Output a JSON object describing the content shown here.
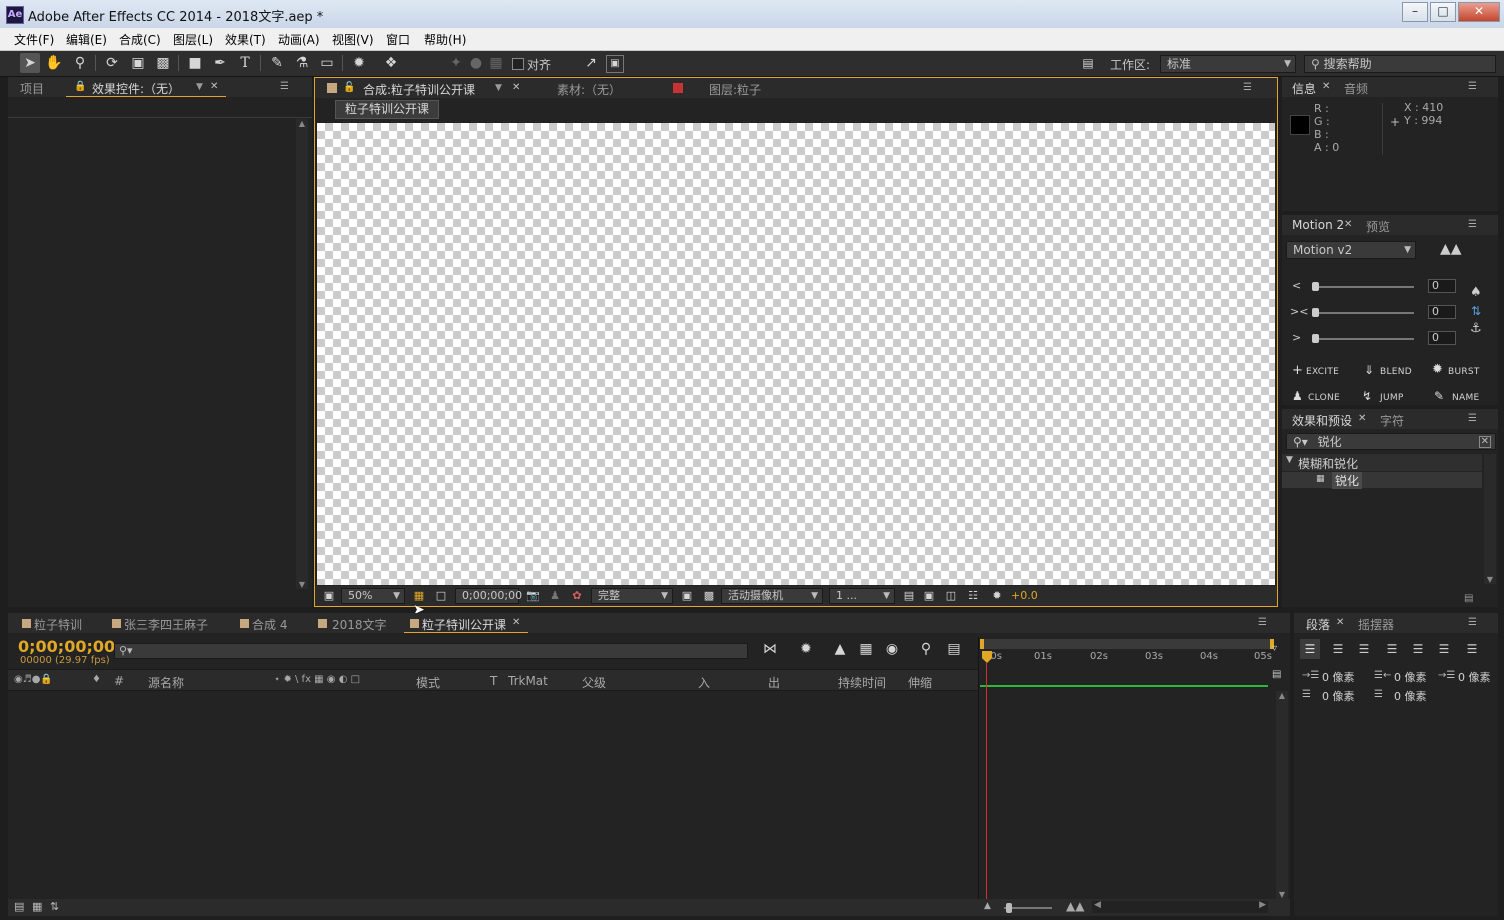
{
  "window": {
    "title": "Adobe After Effects CC 2014 - 2018文字.aep *",
    "app_icon": "Ae",
    "controls": [
      "minimize-icon",
      "maximize-icon",
      "close-icon"
    ]
  },
  "menu": [
    "文件(F)",
    "编辑(E)",
    "合成(C)",
    "图层(L)",
    "效果(T)",
    "动画(A)",
    "视图(V)",
    "窗口",
    "帮助(H)"
  ],
  "toolbar": {
    "snap_label": "对齐",
    "workspace_label": "工作区:",
    "workspace_value": "标准",
    "search_placeholder": "搜索帮助"
  },
  "left_panel": {
    "tabs": [
      "项目",
      "效果控件:（无）"
    ]
  },
  "comp_panel": {
    "tabs": [
      "合成:粒子特训公开课",
      "素材:（无）",
      "图层:粒子"
    ],
    "comp_button": "粒子特训公开课",
    "footer": {
      "zoom": "50%",
      "timecode": "0;00;00;00",
      "quality": "完整",
      "camera": "活动摄像机",
      "views": "1 ...",
      "exposure": "+0.0"
    }
  },
  "info_panel": {
    "tabs": [
      "信息",
      "音频"
    ],
    "rgba": [
      "R :",
      "G :",
      "B :",
      "A : 0"
    ],
    "x": "X : 410",
    "y": "Y : 994"
  },
  "motion_panel": {
    "tabs": [
      "Motion 2",
      "预览"
    ],
    "preset": "Motion v2",
    "values": [
      "0",
      "0",
      "0"
    ],
    "buttons": [
      "EXCITE",
      "BLEND",
      "BURST",
      "CLONE",
      "JUMP",
      "NAME"
    ]
  },
  "effects_panel": {
    "tabs": [
      "效果和预设",
      "字符"
    ],
    "search_value": "锐化",
    "category": "模糊和锐化",
    "item": "锐化"
  },
  "timeline": {
    "tabs": [
      "粒子特训",
      "张三李四王麻子",
      "合成 4",
      "2018文字",
      "粒子特训公开课"
    ],
    "timecode": "0;00;00;00",
    "fps": "00000 (29.97 fps)",
    "columns": [
      "#",
      "源名称",
      "模式",
      "T",
      "TrkMat",
      "父级",
      "入",
      "出",
      "持续时间",
      "伸缩"
    ],
    "ruler": [
      "00s",
      "01s",
      "02s",
      "03s",
      "04s",
      "05s"
    ]
  },
  "paragraph_panel": {
    "tabs": [
      "段落",
      "摇摆器"
    ],
    "values": [
      "0 像素",
      "0 像素",
      "0 像素",
      "0 像素",
      "0 像素"
    ]
  }
}
